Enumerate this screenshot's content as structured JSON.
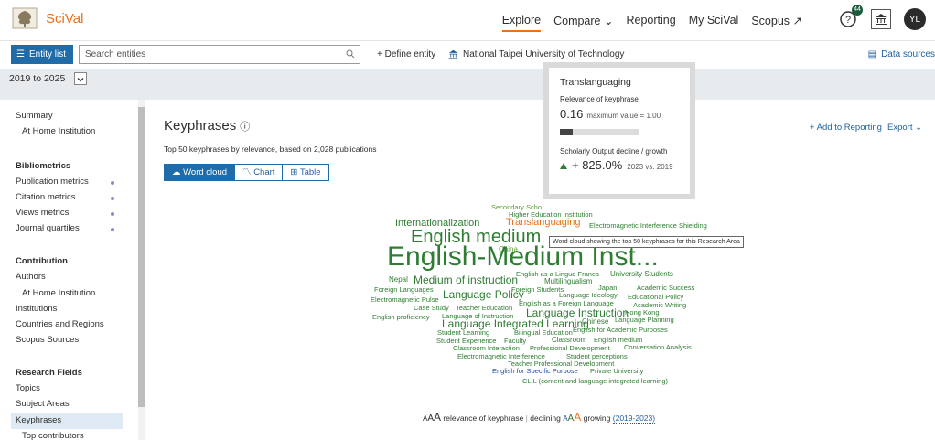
{
  "header": {
    "app_name": "SciVal",
    "nav": [
      "Explore",
      "Compare",
      "Reporting",
      "My SciVal",
      "Scopus"
    ],
    "help_badge": "44",
    "avatar_initials": "YL"
  },
  "toolbar": {
    "entity_list_label": "Entity list",
    "search_placeholder": "Search entities",
    "define_entity": "Define entity",
    "institution": "National Taipei University of Technology",
    "data_sources": "Data sources"
  },
  "year_range": "2019 to 2025",
  "sidebar": {
    "items": [
      {
        "label": "Summary",
        "type": "item"
      },
      {
        "label": "At Home Institution",
        "type": "sub"
      },
      {
        "label": "Bibliometrics",
        "type": "head"
      },
      {
        "label": "Publication metrics",
        "type": "item"
      },
      {
        "label": "Citation metrics",
        "type": "item"
      },
      {
        "label": "Views metrics",
        "type": "item"
      },
      {
        "label": "Journal quartiles",
        "type": "item"
      },
      {
        "label": "Contribution",
        "type": "head"
      },
      {
        "label": "Authors",
        "type": "item"
      },
      {
        "label": "At Home Institution",
        "type": "sub"
      },
      {
        "label": "Institutions",
        "type": "item"
      },
      {
        "label": "Countries and Regions",
        "type": "item"
      },
      {
        "label": "Scopus Sources",
        "type": "item"
      },
      {
        "label": "Research Fields",
        "type": "head"
      },
      {
        "label": "Topics",
        "type": "item"
      },
      {
        "label": "Subject Areas",
        "type": "item"
      },
      {
        "label": "Keyphrases",
        "type": "item"
      },
      {
        "label": "Top contributors",
        "type": "sub"
      }
    ]
  },
  "main": {
    "title": "Keyphrases",
    "subtitle": "Top 50 keyphrases by relevance, based on 2,028 publications",
    "tabs": [
      "Word cloud",
      "Chart",
      "Table"
    ],
    "add_to_reporting": "+ Add to Reporting",
    "export": "Export"
  },
  "popup": {
    "title": "Translanguaging",
    "relevance_label": "Relevance of keyphrase",
    "relevance_value": "0.16",
    "max_value": "maximum value = 1.00",
    "relevance_fraction": 0.16,
    "growth_label": "Scholarly Output decline / growth",
    "growth_value": "+ 825.0%",
    "growth_period": "2023 vs. 2019"
  },
  "tooltip": "Word cloud showing the top 50 keyphrases for this Research Area",
  "word_cloud": [
    {
      "text": "Secondary Scho",
      "color": "lg"
    },
    {
      "text": "Higher Education Institution",
      "color": "dg"
    },
    {
      "text": "Internationalization",
      "color": "dg"
    },
    {
      "text": "Translanguaging",
      "color": "or"
    },
    {
      "text": "Electromagnetic Interference Shielding",
      "color": "dg"
    },
    {
      "text": "English medium",
      "color": "dg"
    },
    {
      "text": "China",
      "color": "lg"
    },
    {
      "text": "English-Medium Inst...",
      "color": "dg"
    },
    {
      "text": "English as a Lingua Franca",
      "color": "dg"
    },
    {
      "text": "University Students",
      "color": "dg"
    },
    {
      "text": "Nepal",
      "color": "dg"
    },
    {
      "text": "Medium of instruction",
      "color": "dg"
    },
    {
      "text": "Multilingualism",
      "color": "dg"
    },
    {
      "text": "Foreign Languages",
      "color": "dg"
    },
    {
      "text": "Foreign Students",
      "color": "dg"
    },
    {
      "text": "Japan",
      "color": "dg"
    },
    {
      "text": "Academic Success",
      "color": "dg"
    },
    {
      "text": "Language Policy",
      "color": "dg"
    },
    {
      "text": "Language Ideology",
      "color": "dg"
    },
    {
      "text": "Educational Policy",
      "color": "dg"
    },
    {
      "text": "Electromagnetic Pulse",
      "color": "dg"
    },
    {
      "text": "English as a Foreign Language",
      "color": "dg"
    },
    {
      "text": "Academic Writing",
      "color": "dg"
    },
    {
      "text": "Case Study",
      "color": "dg"
    },
    {
      "text": "Teacher Education",
      "color": "dg"
    },
    {
      "text": "Language Instruction",
      "color": "dg"
    },
    {
      "text": "Hong Kong",
      "color": "dg"
    },
    {
      "text": "English proficiency",
      "color": "dg"
    },
    {
      "text": "Language of Instruction",
      "color": "dg"
    },
    {
      "text": "Language Planning",
      "color": "dg"
    },
    {
      "text": "Language Integrated Learning",
      "color": "dg"
    },
    {
      "text": "Chinese",
      "color": "dg"
    },
    {
      "text": "Student Learning",
      "color": "dg"
    },
    {
      "text": "Bilingual Education",
      "color": "dg"
    },
    {
      "text": "English for Academic Purposes",
      "color": "dg"
    },
    {
      "text": "Student Experience",
      "color": "dg"
    },
    {
      "text": "Faculty",
      "color": "dg"
    },
    {
      "text": "Classroom",
      "color": "dg"
    },
    {
      "text": "English medium",
      "color": "dg"
    },
    {
      "text": "Classroom Interaction",
      "color": "dg"
    },
    {
      "text": "Professional Development",
      "color": "dg"
    },
    {
      "text": "Conversation Analysis",
      "color": "dg"
    },
    {
      "text": "Electromagnetic Interference",
      "color": "dg"
    },
    {
      "text": "Student perceptions",
      "color": "dg"
    },
    {
      "text": "Teacher Professional Development",
      "color": "dg"
    },
    {
      "text": "English for Specific Purpose",
      "color": "bl"
    },
    {
      "text": "Private University",
      "color": "dg"
    },
    {
      "text": "CLIL (content and language integrated learning)",
      "color": "dg"
    }
  ],
  "legend": {
    "sizes": [
      "A",
      "A",
      "A"
    ],
    "relevance": "relevance of keyphrase",
    "separator": "|",
    "declining": "declining",
    "colors_sizes": [
      "A",
      "A",
      "A"
    ],
    "growing": "growing",
    "period": "(2019-2023)"
  },
  "colors": {
    "accent": "#e9711c",
    "primary": "#1f6ca8",
    "dark_green": "#2e7d32",
    "light_green": "#5aa02c",
    "blue": "#1a4d9c"
  }
}
